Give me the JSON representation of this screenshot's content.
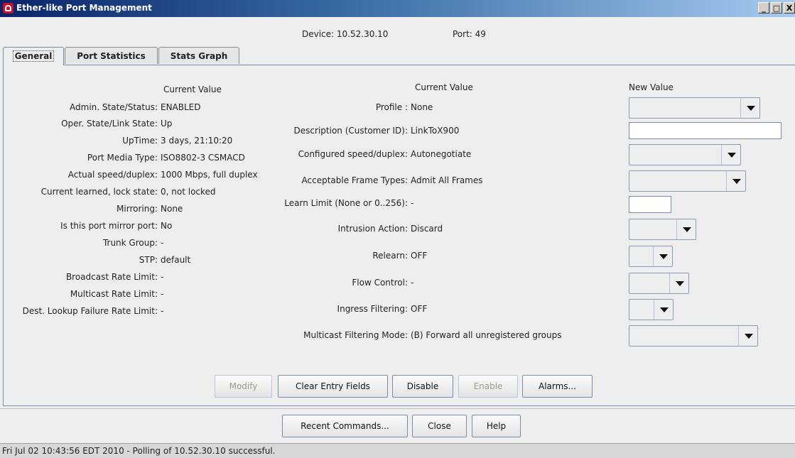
{
  "window": {
    "title": "Ether-like Port Management",
    "min": "_",
    "max": "□",
    "close": "X"
  },
  "header": {
    "device_label": "Device: 10.52.30.10",
    "port_label": "Port: 49"
  },
  "tabs": [
    {
      "label": "General",
      "active": true
    },
    {
      "label": "Port Statistics",
      "active": false
    },
    {
      "label": "Stats Graph",
      "active": false
    }
  ],
  "left": {
    "column_header": "Current Value",
    "rows": [
      {
        "label": "Admin. State/Status:",
        "value": "ENABLED"
      },
      {
        "label": "Oper. State/Link State:",
        "value": "Up"
      },
      {
        "label": "UpTime:",
        "value": "3 days, 21:10:20"
      },
      {
        "label": "Port Media Type:",
        "value": "ISO8802-3 CSMACD"
      },
      {
        "label": "Actual speed/duplex:",
        "value": "1000 Mbps, full duplex"
      },
      {
        "label": "Current learned, lock state:",
        "value": "0, not locked"
      },
      {
        "label": "Mirroring:",
        "value": "None"
      },
      {
        "label": "Is this port mirror port:",
        "value": "No"
      },
      {
        "label": "Trunk Group:",
        "value": "-"
      },
      {
        "label": "STP:",
        "value": "default"
      },
      {
        "label": "Broadcast Rate Limit:",
        "value": "-"
      },
      {
        "label": "Multicast Rate Limit:",
        "value": "-"
      },
      {
        "label": "Dest. Lookup Failure Rate Limit:",
        "value": "-"
      }
    ]
  },
  "right": {
    "current_header": "Current Value",
    "new_header": "New Value",
    "rows": [
      {
        "label": "Profile :",
        "value": "None",
        "control": "combo"
      },
      {
        "label": "Description (Customer ID):",
        "value": "LinkToX900",
        "control": "text",
        "field_value": ""
      },
      {
        "label": "Configured speed/duplex:",
        "value": "Autonegotiate",
        "control": "combo"
      },
      {
        "label": "Acceptable Frame Types:",
        "value": "Admit All Frames",
        "control": "combo"
      },
      {
        "label": "Learn Limit (None or 0..256):",
        "value": "-",
        "control": "text",
        "field_value": ""
      },
      {
        "label": "Intrusion Action:",
        "value": "Discard",
        "control": "combo"
      },
      {
        "label": "Relearn:",
        "value": "OFF",
        "control": "combo"
      },
      {
        "label": "Flow Control:",
        "value": "-",
        "control": "combo"
      },
      {
        "label": "Ingress Filtering:",
        "value": "OFF",
        "control": "combo"
      },
      {
        "label": "Multicast Filtering Mode:",
        "value": "(B) Forward all unregistered groups",
        "control": "combo"
      }
    ]
  },
  "actions": {
    "modify": "Modify",
    "clear": "Clear Entry Fields",
    "disable": "Disable",
    "enable": "Enable",
    "alarms": "Alarms..."
  },
  "footer": {
    "recent": "Recent Commands...",
    "close": "Close",
    "help": "Help"
  },
  "status": "Fri Jul 02 10:43:56 EDT 2010 - Polling of 10.52.30.10 successful."
}
